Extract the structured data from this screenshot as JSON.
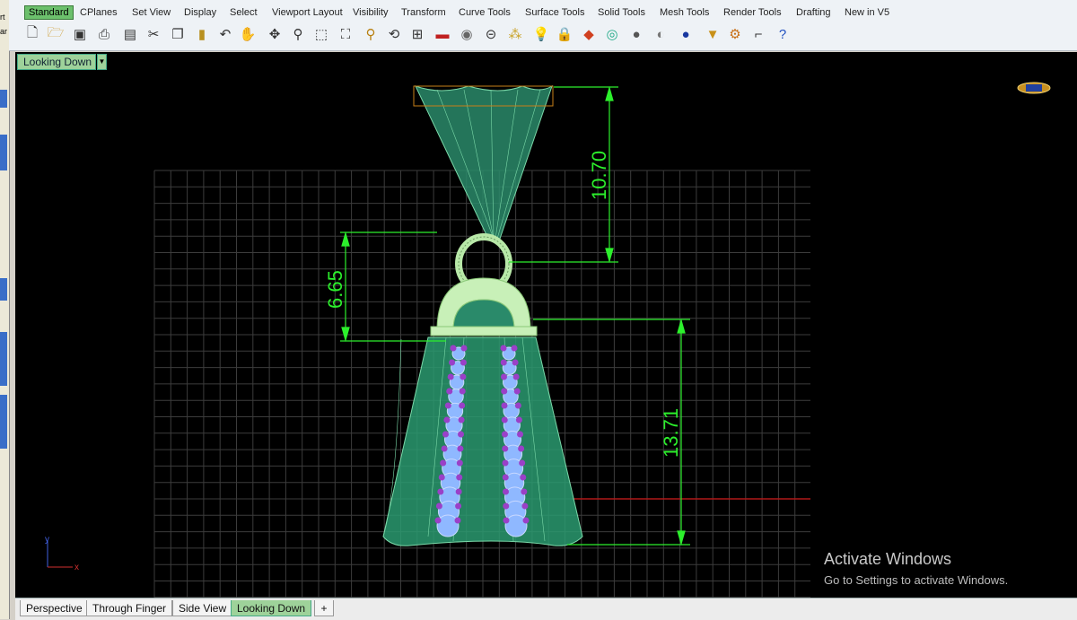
{
  "tabs": [
    {
      "label": "Standard",
      "active": true
    },
    {
      "label": "CPlanes"
    },
    {
      "label": "Set View"
    },
    {
      "label": "Display"
    },
    {
      "label": "Select"
    },
    {
      "label": "Viewport Layout"
    },
    {
      "label": "Visibility"
    },
    {
      "label": "Transform"
    },
    {
      "label": "Curve Tools"
    },
    {
      "label": "Surface Tools"
    },
    {
      "label": "Solid Tools"
    },
    {
      "label": "Mesh Tools"
    },
    {
      "label": "Render Tools"
    },
    {
      "label": "Drafting"
    },
    {
      "label": "New in V5"
    }
  ],
  "toolbar_icons": [
    "new-icon",
    "open-icon",
    "save-icon",
    "print-icon",
    "import-icon",
    "cut-icon",
    "copy-icon",
    "paste-icon",
    "undo-icon",
    "pan-hand-icon",
    "move-icon",
    "zoom-icon",
    "zoom-window-icon",
    "zoom-extents-icon",
    "zoom-selected-icon",
    "rotate-view-icon",
    "four-viewports-icon",
    "car-named-view-icon",
    "camera-icon",
    "cplane-icon",
    "snap-grid-icon",
    "lightbulb-icon",
    "lock-icon",
    "layer-icon",
    "color-wheel-icon",
    "shade-icon",
    "ghosted-icon",
    "render-sphere-icon",
    "rendering-icon",
    "options-gear-icon",
    "dimension-icon",
    "help-icon"
  ],
  "viewport": {
    "title": "Looking Down",
    "dimensions": {
      "top": "10.70",
      "middle": "6.65",
      "bottom": "13.71"
    },
    "axis_x": "x",
    "axis_y": "y"
  },
  "bottom_tabs": [
    {
      "label": "Perspective"
    },
    {
      "label": "Through Finger"
    },
    {
      "label": "Side View"
    },
    {
      "label": "Looking Down",
      "active": true
    }
  ],
  "add_tab_symbol": "+",
  "left_labels": [
    "rt",
    "ar"
  ],
  "watermark": {
    "title": "Activate Windows",
    "subtitle": "Go to Settings to activate Windows."
  },
  "colors": {
    "viewport_bg": "#000000",
    "dimension": "#2cf02c",
    "model": "#3aa878",
    "gem": "#8fb8ff",
    "prong": "#9a40c8",
    "active_tab": "#9ed29a"
  }
}
